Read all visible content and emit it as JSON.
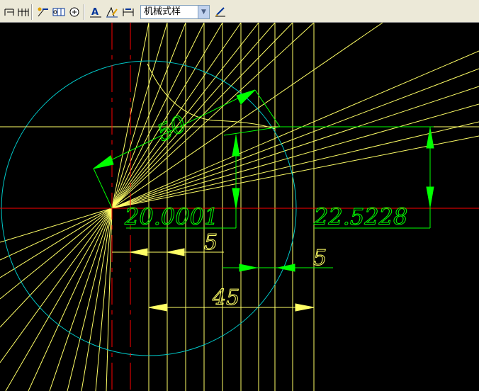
{
  "toolbar": {
    "dimension_style": "机械式样",
    "tools": [
      {
        "name": "baseline-dimension-icon",
        "glyph": "⊐"
      },
      {
        "name": "continue-dimension-icon",
        "glyph": "⊞"
      },
      {
        "name": "quick-leader-icon",
        "glyph": "✎"
      },
      {
        "name": "tolerance-icon",
        "glyph": "⊟"
      },
      {
        "name": "center-mark-icon",
        "glyph": "⊕"
      },
      {
        "name": "dimension-edit-icon",
        "glyph": "A"
      },
      {
        "name": "dimension-text-edit-icon",
        "glyph": "A"
      },
      {
        "name": "dimension-update-icon",
        "glyph": "⊏"
      },
      {
        "name": "dimension-style-icon",
        "glyph": "✎"
      }
    ]
  },
  "drawing": {
    "dimensions": {
      "radius": "50",
      "left_height": "20.0001",
      "right_height": "22.5228",
      "spacing_left": "5",
      "spacing_right": "5",
      "width": "45"
    },
    "colors": {
      "background": "#000000",
      "circle": "#00c8c8",
      "construction": "#ffff66",
      "dimension": "#00ff00",
      "centerline": "#ff0000"
    }
  }
}
